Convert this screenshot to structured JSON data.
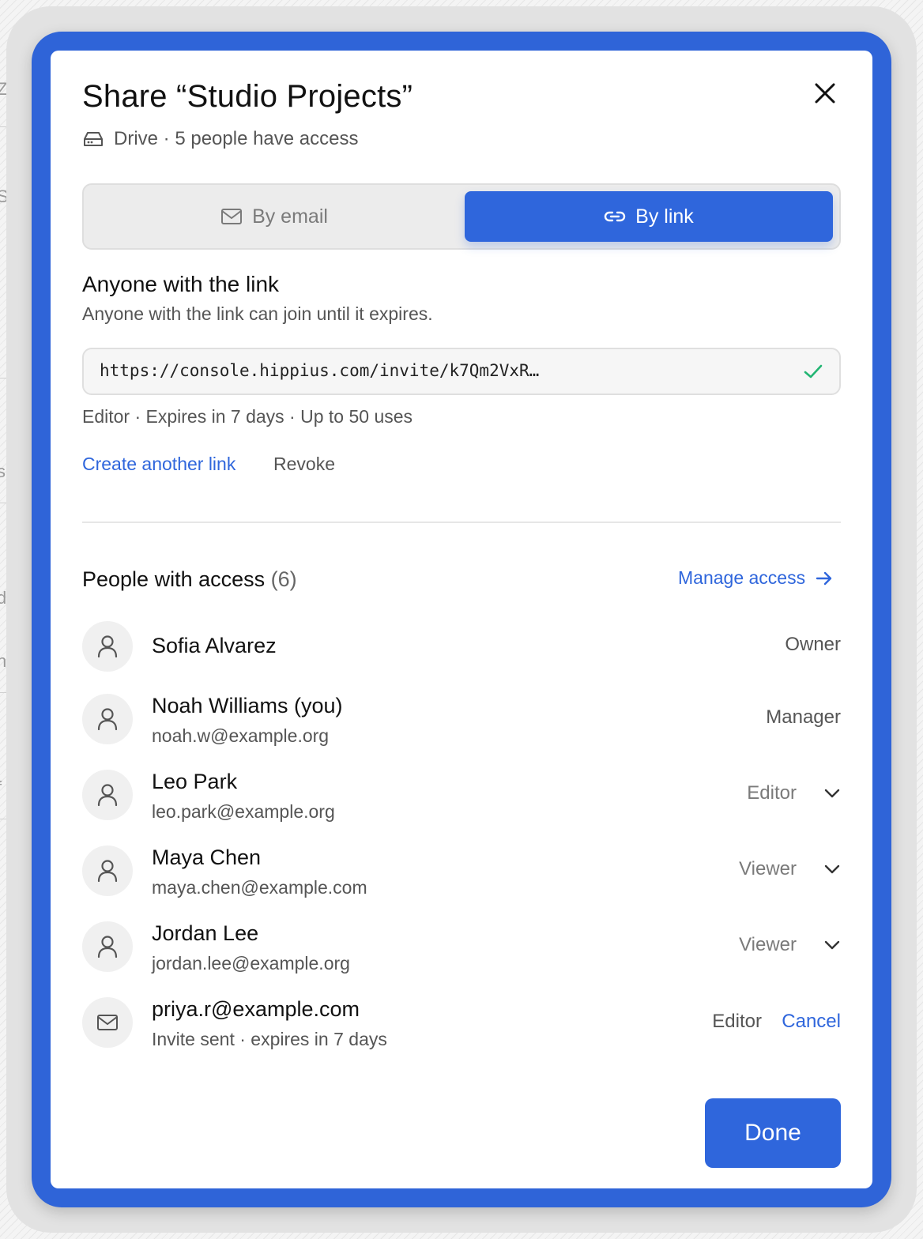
{
  "background": {
    "fragments": [
      "Z",
      "St",
      "s",
      "d",
      "ng",
      "f"
    ]
  },
  "dialog": {
    "title": "Share “Studio Projects”",
    "subtitle": "Drive · 5 people have access",
    "close_icon": "close-icon",
    "drive_icon": "drive-icon"
  },
  "tabs": [
    {
      "label": "By email",
      "icon": "mail-icon",
      "selected": false
    },
    {
      "label": "By link",
      "icon": "link-icon",
      "selected": true
    }
  ],
  "link_section": {
    "heading": "Anyone with the link",
    "description": "Anyone with the link can join until it expires.",
    "url": "https://console.hippius.com/invite/k7Qm2VxR…",
    "status_icon": "check-icon",
    "meta": "Editor · Expires in 7 days · Up to 50 uses",
    "create_label": "Create another link",
    "revoke_label": "Revoke"
  },
  "people": {
    "heading": "People with access",
    "count": "(6)",
    "manage_label": "Manage access",
    "list": [
      {
        "name": "Sofia Alvarez",
        "email": "",
        "role": "Owner",
        "editable": false
      },
      {
        "name": "Noah Williams (you)",
        "email": "noah.w@example.org",
        "role": "Manager",
        "editable": false
      },
      {
        "name": "Leo Park",
        "email": "leo.park@example.org",
        "role": "Editor",
        "editable": true
      },
      {
        "name": "Maya Chen",
        "email": "maya.chen@example.com",
        "role": "Viewer",
        "editable": true
      },
      {
        "name": "Jordan Lee",
        "email": "jordan.lee@example.org",
        "role": "Viewer",
        "editable": true
      },
      {
        "name": "priya.r@example.com",
        "email": "Invite sent · expires in 7 days",
        "role": "Editor",
        "editable": false,
        "pending": true,
        "action": "Cancel"
      }
    ]
  },
  "footer": {
    "done_label": "Done"
  },
  "colors": {
    "accent": "#2f66dc",
    "frame": "#2f64d8",
    "success": "#22b573"
  }
}
